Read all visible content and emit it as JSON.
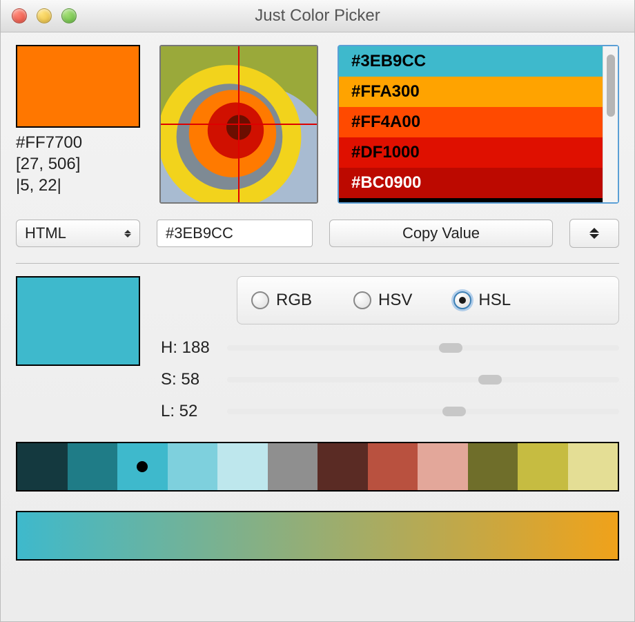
{
  "title": "Just Color Picker",
  "current": {
    "swatch_color": "#FF7700",
    "hex_label": "#FF7700",
    "coords_label": "[27, 506]",
    "delta_label": "|5, 22|"
  },
  "color_list": [
    {
      "hex": "#3EB9CC",
      "bg": "#3EB9CC",
      "text": "#000000",
      "selected": false
    },
    {
      "hex": "#FFA300",
      "bg": "#FFA300",
      "text": "#000000",
      "selected": false
    },
    {
      "hex": "#FF4A00",
      "bg": "#FF4A00",
      "text": "#000000",
      "selected": false
    },
    {
      "hex": "#DF1000",
      "bg": "#DF1000",
      "text": "#000000",
      "selected": false
    },
    {
      "hex": "#BC0900",
      "bg": "#BC0900",
      "text": "#FFFFFF",
      "selected": true
    },
    {
      "hex": "",
      "bg": "#000000",
      "text": "#FFFFFF",
      "selected": false
    }
  ],
  "format_select": {
    "value": "HTML"
  },
  "value_input": "#3EB9CC",
  "copy_button_label": "Copy Value",
  "modes": {
    "options": [
      {
        "key": "RGB",
        "label": "RGB",
        "selected": false
      },
      {
        "key": "HSV",
        "label": "HSV",
        "selected": false
      },
      {
        "key": "HSL",
        "label": "HSL",
        "selected": true
      }
    ]
  },
  "hsl_swatch_color": "#3EB9CC",
  "sliders": {
    "h": {
      "label": "H: 188",
      "value": 188,
      "max": 360,
      "pos_pct": 57
    },
    "s": {
      "label": "S: 58",
      "value": 58,
      "max": 100,
      "pos_pct": 67
    },
    "l": {
      "label": "L: 52",
      "value": 52,
      "max": 100,
      "pos_pct": 58
    }
  },
  "palette": [
    {
      "color": "#14393F",
      "marker": false
    },
    {
      "color": "#1F7C87",
      "marker": false
    },
    {
      "color": "#3EB9CC",
      "marker": true
    },
    {
      "color": "#7ED0DD",
      "marker": false
    },
    {
      "color": "#BEE7ED",
      "marker": false
    },
    {
      "color": "#8F8F8F",
      "marker": false
    },
    {
      "color": "#5A2B24",
      "marker": false
    },
    {
      "color": "#B9513F",
      "marker": false
    },
    {
      "color": "#E3A79A",
      "marker": false
    },
    {
      "color": "#6F6E2A",
      "marker": false
    },
    {
      "color": "#C6BC41",
      "marker": false
    },
    {
      "color": "#E4DE95",
      "marker": false
    }
  ],
  "gradient": {
    "from": "#3EB9CC",
    "to": "#F0A21A"
  }
}
